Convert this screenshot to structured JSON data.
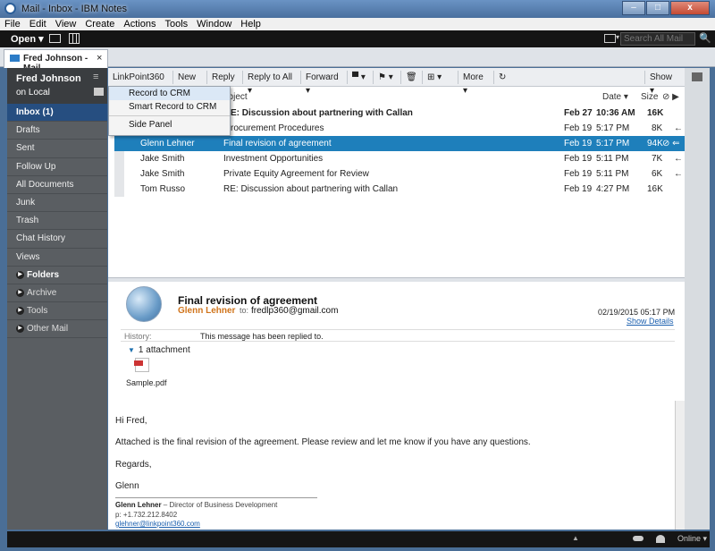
{
  "window": {
    "title": "Mail - Inbox - IBM Notes",
    "min": "–",
    "max": "□",
    "close": "x"
  },
  "menu": [
    "File",
    "Edit",
    "View",
    "Create",
    "Actions",
    "Tools",
    "Window",
    "Help"
  ],
  "topbar": {
    "open_label": "Open ▾",
    "search_placeholder": "Search All Mail",
    "search_go": "🔍"
  },
  "tab": {
    "label": "Fred Johnson - Mail",
    "close": "×"
  },
  "sidebar": {
    "user": "Fred Johnson",
    "location": "on Local",
    "menu_icon": "≡",
    "items": [
      {
        "label": "Inbox (1)"
      },
      {
        "label": "Drafts"
      },
      {
        "label": "Sent"
      },
      {
        "label": "Follow Up"
      },
      {
        "label": "All Documents"
      },
      {
        "label": "Junk"
      },
      {
        "label": "Trash"
      },
      {
        "label": "Chat History"
      },
      {
        "label": "Views"
      },
      {
        "label": "Folders"
      },
      {
        "label": "Archive"
      },
      {
        "label": "Tools"
      },
      {
        "label": "Other Mail"
      }
    ]
  },
  "toolbar": {
    "linkpoint": "LinkPoint360 ▾",
    "new": "New ▾",
    "reply": "Reply ▾",
    "reply_all": "Reply to All ▾",
    "forward": "Forward ▾",
    "folder": "▀ ▾",
    "flag": "⚑ ▾",
    "trash": "🗑",
    "add": "⊞ ▾",
    "more": "More ▾",
    "refresh": "↻",
    "show": "Show ▾"
  },
  "dropdown": [
    "Record to CRM",
    "Smart Record to CRM",
    "Side Panel"
  ],
  "list": {
    "headers": {
      "subject": "ubject",
      "date": "Date ▾",
      "size": "Size",
      "icons": "⊘ ▶"
    },
    "rows": [
      {
        "who": "",
        "subject": "E: Discussion about partnering with Callan",
        "date": "Feb 27",
        "time": "10:36 AM",
        "size": "16K",
        "flag": ""
      },
      {
        "who": "",
        "subject": "rocurement Procedures",
        "date": "Feb 19",
        "time": "5:17 PM",
        "size": "8K",
        "flag": "←"
      },
      {
        "who": "Glenn Lehner",
        "subject": "Final revision of agreement",
        "date": "Feb 19",
        "time": "5:17 PM",
        "size": "94K",
        "flag": "⊘ ⇐"
      },
      {
        "who": "Jake Smith",
        "subject": "Investment Opportunities",
        "date": "Feb 19",
        "time": "5:11 PM",
        "size": "7K",
        "flag": "←"
      },
      {
        "who": "Jake Smith",
        "subject": "Private Equity Agreement for Review",
        "date": "Feb 19",
        "time": "5:11 PM",
        "size": "6K",
        "flag": "←"
      },
      {
        "who": "Tom Russo",
        "subject": "RE: Discussion about partnering with Callan",
        "date": "Feb 19",
        "time": "4:27 PM",
        "size": "16K",
        "flag": ""
      }
    ]
  },
  "preview": {
    "subject": "Final revision of agreement",
    "from": "Glenn Lehner",
    "to_label": "to:",
    "to": "fredlp360@gmail.com",
    "date": "02/19/2015 05:17 PM",
    "show_details": "Show Details",
    "history_label": "History:",
    "history_value": "This message has been replied to.",
    "attachments": "1 attachment",
    "attachment_name": "Sample.pdf",
    "body": [
      "Hi Fred,",
      "Attached is the final revision of the agreement. Please review and let me know if you have any questions.",
      "Regards,",
      "Glenn"
    ],
    "sig_name": "Glenn Lehner",
    "sig_title": " – Director of Business Development",
    "sig_phone": "p: +1.732.212.8402",
    "sig_email": "glehner@linkpoint360.com"
  },
  "status": {
    "online": "Online ▾",
    "up": "▲"
  }
}
